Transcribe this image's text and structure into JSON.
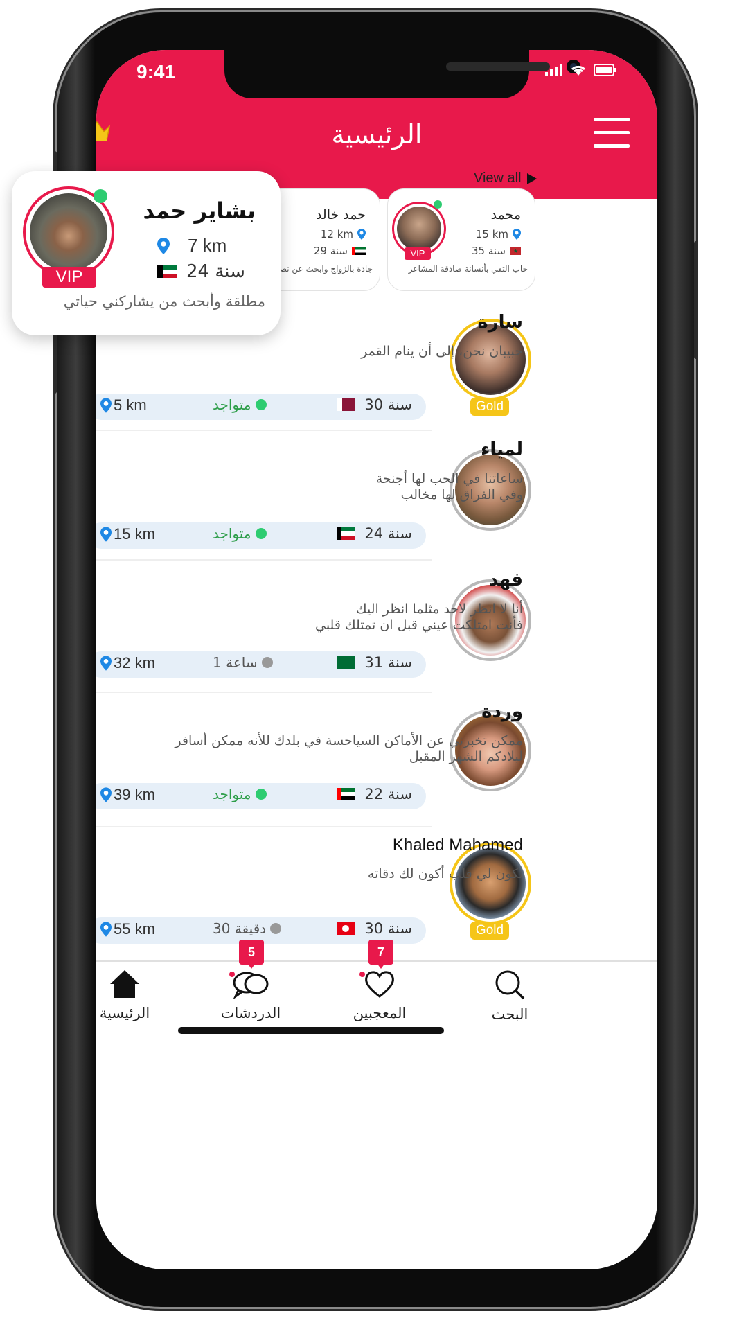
{
  "status_bar": {
    "time": "9:41"
  },
  "header": {
    "title": "الرئيسية"
  },
  "view_all": "View all",
  "stories": [
    {
      "name": "محمد",
      "km": "15 km",
      "age": "35 سنة",
      "badge": "VIP",
      "bio": "حاب التقي بأنسانة صادقة المشاعر"
    },
    {
      "name": "حمد خالد",
      "km": "12 km",
      "age": "29 سنة",
      "bio": "جادة بالزواج وابحث عن نصفي"
    }
  ],
  "featured": {
    "name": "بشاير حمد",
    "km": "7 km",
    "age": "24 سنة",
    "badge": "VIP",
    "bio": "مطلقة وأبحث من يشاركني حياتي"
  },
  "users": [
    {
      "name": "سارة",
      "bio": "حبيبان نحن، إلى أن ينام القمر",
      "km": "5 km",
      "status": "متواجد",
      "age": "30 سنة",
      "badge": "Gold"
    },
    {
      "name": "لمياء",
      "bio_line1": "ساعاتنا في الحب لها أجنحة",
      "bio_line2": "وفي الفراق لها مخالب",
      "km": "15 km",
      "status": "متواجد",
      "age": "24 سنة"
    },
    {
      "name": "فهد",
      "bio_line1": "أنا لا انظر لاحد مثلما انظر اليك",
      "bio_line2": "فأنت امتلكت عيني قبل ان تمتلك قلبي",
      "km": "32 km",
      "status": "1 ساعة",
      "age": "31 سنة"
    },
    {
      "name": "وردة",
      "bio_line1": "ممكن تخبرني عن الأماكن السياحسة في بلدك للأنه ممكن أسافر",
      "bio_line2": "لبلادكم الشهر المقبل",
      "km": "39 km",
      "status": "متواجد",
      "age": "22 سنة"
    },
    {
      "name": "Khaled Mahamed",
      "bio": "تكون لي قلب أكون لك دقاته",
      "km": "55 km",
      "status": "30 دقيقة",
      "age": "30 سنة",
      "badge": "Gold"
    }
  ],
  "tabs": {
    "home": "الرئيسية",
    "chats": "الدردشات",
    "likes": "المعجبين",
    "search": "البحث"
  },
  "counters": {
    "chats": "5",
    "likes": "7"
  },
  "colors": {
    "brand": "#e8194b",
    "gold": "#f5c518",
    "online": "#2ecc71",
    "offline": "#999999",
    "pill": "#e6eff8"
  }
}
